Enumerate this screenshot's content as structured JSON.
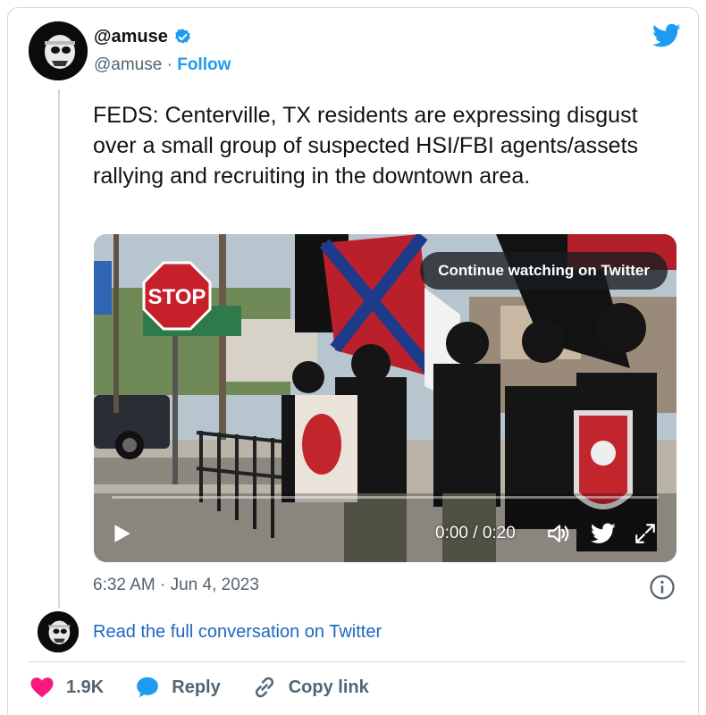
{
  "author": {
    "display_name": "@amuse",
    "handle": "@amuse",
    "separator": "·",
    "follow_label": "Follow"
  },
  "tweet": {
    "text": "FEDS: Centerville, TX residents are expressing disgust over a small group of suspected HSI/FBI agents/assets rallying and recruiting in the downtown area.",
    "timestamp": "6:32 AM · Jun 4, 2023"
  },
  "media": {
    "continue_label": "Continue watching on Twitter",
    "time": "0:00 / 0:20",
    "progress": 0,
    "stop_sign_text": "STOP"
  },
  "conversation": {
    "read_link": "Read the full conversation on Twitter"
  },
  "actions": {
    "like_count": "1.9K",
    "reply_label": "Reply",
    "copy_label": "Copy link"
  },
  "colors": {
    "accent": "#1d9bf0",
    "like": "#f91880",
    "text_secondary": "#536471"
  },
  "icons": [
    "verified-badge-icon",
    "twitter-bird-icon",
    "play-icon",
    "volume-icon",
    "fullscreen-icon",
    "info-icon",
    "heart-icon",
    "reply-bubble-icon",
    "link-icon"
  ]
}
